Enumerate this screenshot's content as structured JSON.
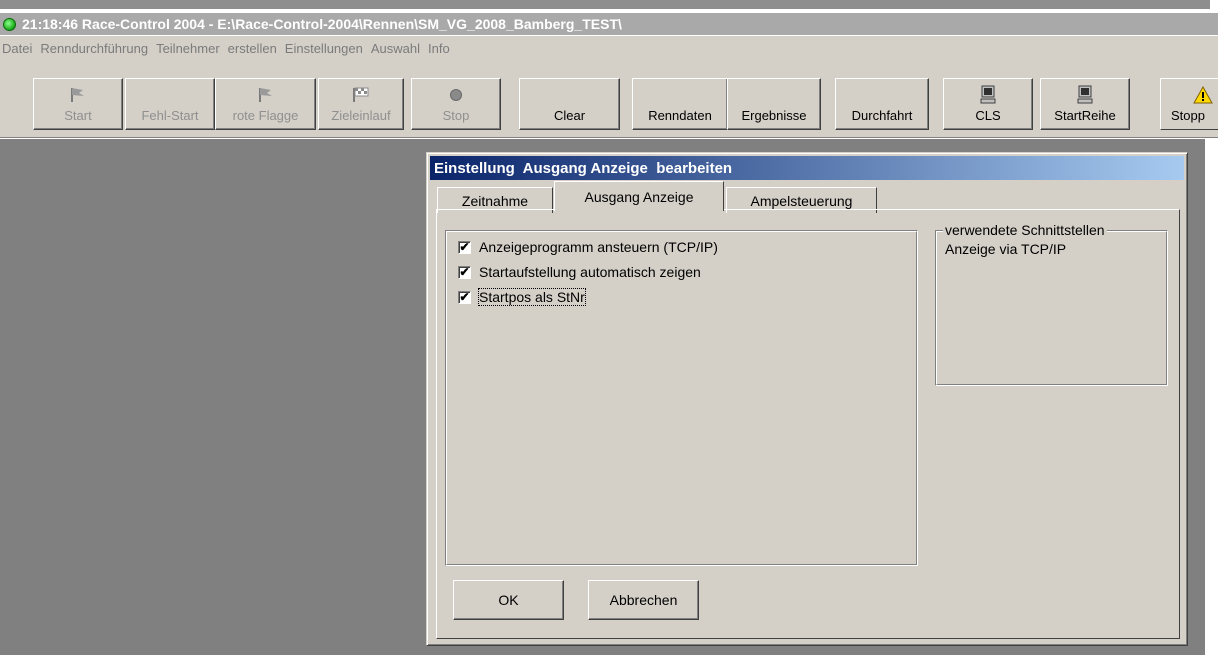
{
  "window": {
    "title": "21:18:46 Race-Control 2004 - E:\\Race-Control-2004\\Rennen\\SM_VG_2008_Bamberg_TEST\\"
  },
  "menu": [
    "Datei",
    "Renndurchführung",
    "Teilnehmer",
    "erstellen",
    "Einstellungen",
    "Auswahl",
    "Info"
  ],
  "toolbar": {
    "start": "Start",
    "fehlstart": "Fehl-Start",
    "rote_flagge": "rote Flagge",
    "zieleinlauf": "Zieleinlauf",
    "stop": "Stop",
    "clear": "Clear",
    "renndaten": "Renndaten",
    "ergebnisse": "Ergebnisse",
    "durchfahrt": "Durchfahrt",
    "cls": "CLS",
    "startreihe": "StartReihe",
    "stopp": "Stopp"
  },
  "icons": {
    "flag": "flag-icon",
    "checkered": "checkered-flag-icon",
    "stop": "stop-circle-icon",
    "computer": "computer-icon",
    "warning": "warning-icon"
  },
  "dialog": {
    "title": "Einstellung  Ausgang Anzeige  bearbeiten",
    "tabs": [
      "Zeitnahme",
      "Ausgang Anzeige",
      "Ampelsteuerung"
    ],
    "active_tab": "Ausgang Anzeige",
    "options": [
      {
        "label": "Anzeigeprogramm ansteuern (TCP/IP)",
        "checked": true
      },
      {
        "label": "Startaufstellung automatisch zeigen",
        "checked": true
      },
      {
        "label": "Startpos als StNr",
        "checked": true
      }
    ],
    "interfaces": {
      "legend": "verwendete Schnittstellen",
      "value": "Anzeige via TCP/IP"
    },
    "ok": "OK",
    "cancel": "Abbrechen"
  },
  "colors": {
    "titlebar_inactive": "#a9a9a9",
    "dialog_title_start": "#0a246a",
    "dialog_title_end": "#a6caf0",
    "face": "#d4d0c8",
    "workspace": "#808080",
    "status_dot": "#16a616"
  }
}
